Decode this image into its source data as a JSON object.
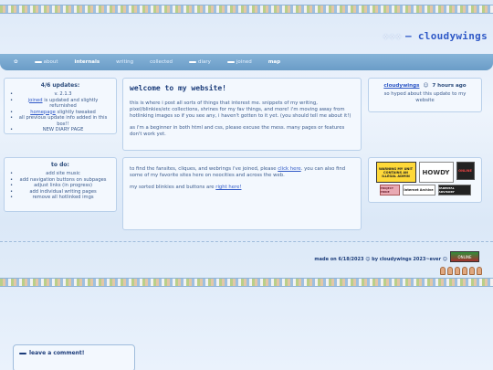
{
  "site": {
    "title": "cloudywings",
    "title_prefix": "— ",
    "sparkle": "✧✧✧"
  },
  "nav": {
    "items": [
      {
        "label": "about",
        "bold": false,
        "dash": true
      },
      {
        "label": "internals",
        "bold": true,
        "dash": false
      },
      {
        "label": "writing",
        "bold": false,
        "dash": false
      },
      {
        "label": "collected",
        "bold": false,
        "dash": false
      },
      {
        "label": "diary",
        "bold": false,
        "dash": true
      },
      {
        "label": "joined",
        "bold": false,
        "dash": true
      },
      {
        "label": "map",
        "bold": true,
        "dash": false
      }
    ]
  },
  "updates": {
    "title": "4/6 updates:",
    "items": [
      {
        "pre": "",
        "link": "",
        "text": "v. 2.1.3"
      },
      {
        "pre": "",
        "link": "joined",
        "text": "is updated and slightly refurnished"
      },
      {
        "pre": "",
        "link": "homepage",
        "text": "slightly tweaked"
      },
      {
        "pre": "",
        "link": "",
        "text": "all previous update info added in this box!!"
      },
      {
        "pre": "",
        "link": "",
        "text": "NEW DIARY PAGE"
      }
    ]
  },
  "todo": {
    "title": "to do:",
    "items": [
      "add site music",
      "add navigation buttons on subpages",
      "adjust links (in progress)",
      "add individual writing pages",
      "remove all hotlinked imgs"
    ]
  },
  "welcome": {
    "title": "welcome to my website!",
    "p1": "this is where i post all sorts of things that interest me. snippets of my writing, pixel/blinkies/etc collections, shrines for my fav things, and more! i'm moving away from hotlinking images so if you see any, i haven't gotten to it yet. (you should tell me about it!)",
    "p2": "as i'm a beginner in both html and css, please excuse the mess. many pages or features don't work yet."
  },
  "links": {
    "p1_before": "to find the fansites, cliques, and webrings i've joined, please ",
    "p1_link": "click here",
    "p1_after": ". you can also find some of my favorite sites here on neocities and across the web.",
    "p2_before": "my sorted blinkies and buttons are ",
    "p2_link": "right here!"
  },
  "status": {
    "name": "cloudywings",
    "icon": "☺",
    "time": "7 hours ago",
    "message": "so hyped about this update to my website"
  },
  "buttons": {
    "warning": "WARNING MY UNIT CONTAINS AN ILLEGAL ADMIN",
    "howdy": "HOWDY",
    "small": "ONLINE",
    "project": "PROJECT PRIDE",
    "archive": "Internet Archive",
    "parental": "PARENTAL ADVISORY"
  },
  "footer": {
    "text": "made on 6/18/2023 ☺ by cloudywings 2023~ever ☺",
    "badge": "ONLINE"
  },
  "comment": {
    "title": "leave a comment!"
  }
}
